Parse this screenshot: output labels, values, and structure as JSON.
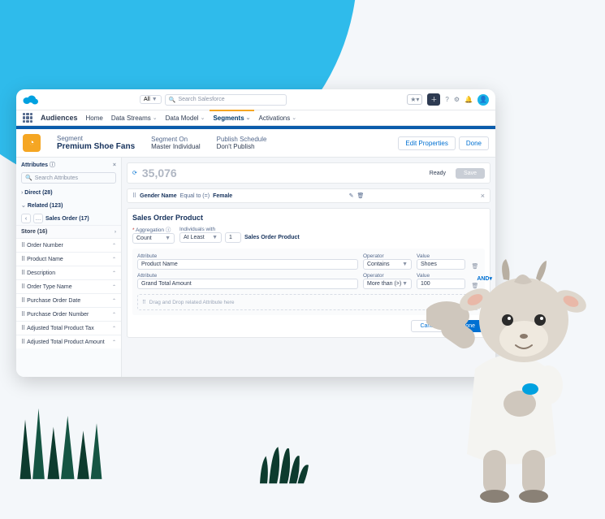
{
  "topbar": {
    "all_label": "All",
    "search_placeholder": "Search Salesforce"
  },
  "nav": {
    "app_name": "Audiences",
    "items": [
      "Home",
      "Data Streams",
      "Data Model",
      "Segments",
      "Activations"
    ]
  },
  "header": {
    "eyebrow": "Segment",
    "title": "Premium Shoe Fans",
    "segment_on_label": "Segment On",
    "segment_on_value": "Master Individual",
    "publish_label": "Publish Schedule",
    "publish_value": "Don't Publish",
    "edit_btn": "Edit Properties",
    "done_btn": "Done"
  },
  "sidebar": {
    "title": "Attributes",
    "search_placeholder": "Search Attributes",
    "sections": {
      "direct": "Direct (28)",
      "related": "Related (123)"
    },
    "crumb": "Sales Order (17)",
    "store": "Store (16)",
    "rows": [
      "Order Number",
      "Product Name",
      "Description",
      "Order Type Name",
      "Purchase Order Date",
      "Purchase Order Number",
      "Adjusted Total Product Tax",
      "Adjusted Total Product Amount"
    ]
  },
  "main": {
    "count": "35,076",
    "ready": "Ready",
    "save": "Save",
    "filter_bar": {
      "attr": "Gender Name",
      "op": "Equal to (=)",
      "val": "Female"
    },
    "card": {
      "title": "Sales Order Product",
      "agg_label": "Aggregation",
      "agg_value": "Count",
      "indiv_label": "Individuals with",
      "indiv_op": "At Least",
      "indiv_n": "1",
      "indiv_entity": "Sales Order Product",
      "cols": {
        "attr": "Attribute",
        "op": "Operator",
        "val": "Value"
      },
      "rows": [
        {
          "attr": "Product Name",
          "op": "Contains",
          "val": "Shoes"
        },
        {
          "attr": "Grand Total Amount",
          "op": "More than (>)",
          "val": "100"
        }
      ],
      "dropzone": "Drag and Drop related Attribute here",
      "cancel": "Cancel",
      "done": "Done"
    },
    "and_label": "AND"
  }
}
